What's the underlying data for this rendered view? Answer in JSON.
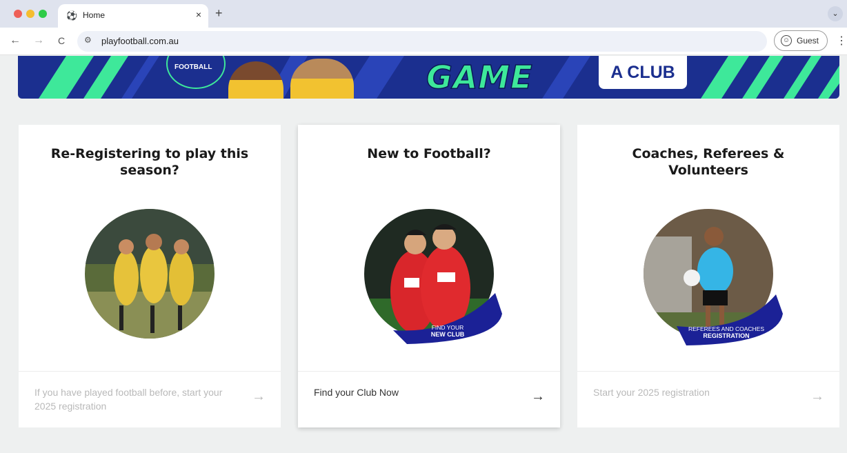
{
  "browser": {
    "tab_title": "Home",
    "tab_close": "×",
    "new_tab": "+",
    "tab_menu": "⌄",
    "back": "←",
    "forward": "→",
    "reload": "C",
    "url": "playfootball.com.au",
    "profile_label": "Guest",
    "menu": "⋮"
  },
  "hero": {
    "logo_text": "FOOTBALL",
    "headline": "GAME",
    "cta": "A CLUB"
  },
  "cards": [
    {
      "title": "Re-Registering to play this season?",
      "footer_text": "If you have played football before, start your 2025 registration",
      "arrow": "→"
    },
    {
      "title": "New to Football?",
      "badge_line1": "FIND YOUR",
      "badge_line2": "NEW CLUB",
      "footer_text": "Find your Club Now",
      "arrow": "→"
    },
    {
      "title": "Coaches, Referees & Volunteers",
      "badge_line1": "REFEREES AND COACHES",
      "badge_line2": "REGISTRATION",
      "footer_text": "Start your 2025 registration",
      "arrow": "→"
    }
  ],
  "colors": {
    "brand_navy": "#1b2f8f",
    "brand_green": "#3ee89a",
    "page_bg": "#eef0f0"
  }
}
